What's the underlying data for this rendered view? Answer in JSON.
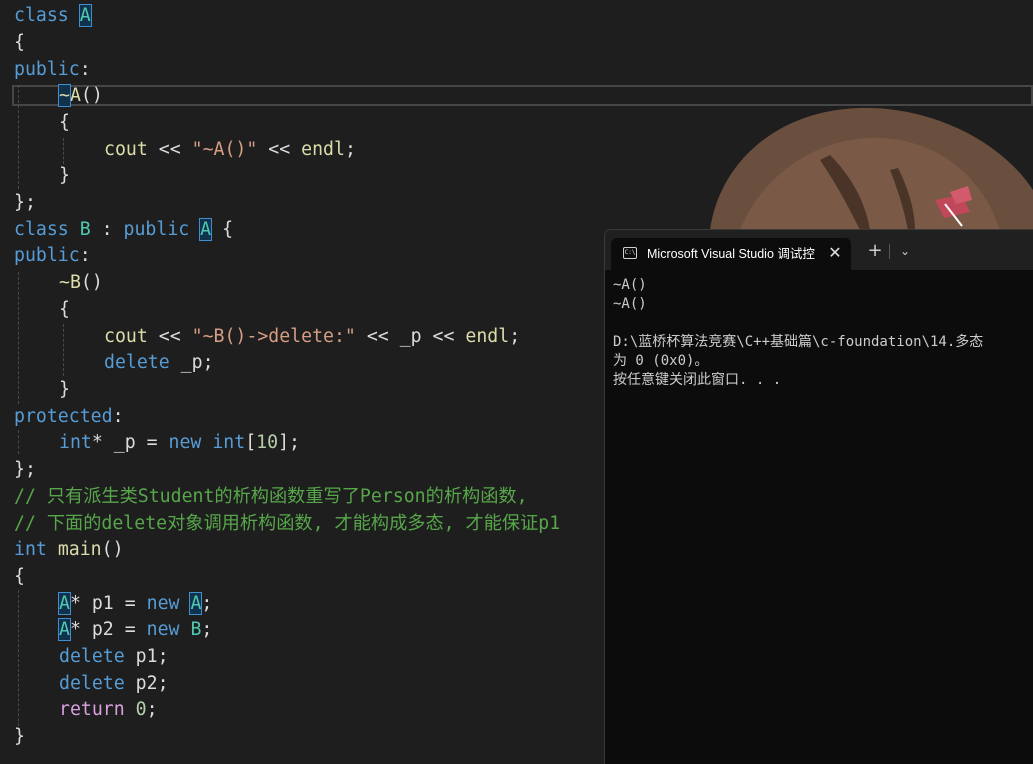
{
  "editor": {
    "lines": [
      [
        "class ",
        " ",
        "A",
        "\n{"
      ],
      [],
      [
        "public",
        ":"
      ],
      [
        "~",
        "A",
        "()"
      ],
      [
        "{"
      ],
      [
        "cout",
        " << ",
        "\"~A()\"",
        " << ",
        "endl",
        ";"
      ],
      [
        "}"
      ],
      [
        "};"
      ],
      [
        "class ",
        "B",
        " : ",
        "public ",
        "A",
        " {"
      ],
      [
        "public",
        ":"
      ],
      [
        "~B",
        "()"
      ],
      [
        "{"
      ],
      [
        "cout",
        " << ",
        "\"~B()->delete:\"",
        " << ",
        "_p",
        " << ",
        "endl",
        ";"
      ],
      [
        "delete ",
        "_p",
        ";"
      ],
      [
        "}"
      ],
      [
        "protected",
        ":"
      ],
      [
        "int",
        "* ",
        "_p",
        " = ",
        "new ",
        "int",
        "[",
        "10",
        "];"
      ],
      [
        "};"
      ],
      [
        "// 只有派生类Student的析构函数重写了Person的析构函数,"
      ],
      [
        "// 下面的delete对象调用析构函数, 才能构成多态, 才能保证p1"
      ],
      [
        "int ",
        "main",
        "()"
      ],
      [
        "{"
      ],
      [
        "A",
        "* ",
        "p1",
        " = ",
        "new ",
        "A",
        ";"
      ],
      [
        "A",
        "* ",
        "p2",
        " = ",
        "new ",
        "B",
        ";"
      ],
      [
        "delete ",
        "p1",
        ";"
      ],
      [
        "delete ",
        "p2",
        ";"
      ],
      [
        "return ",
        "0",
        ";"
      ],
      [
        "}"
      ]
    ]
  },
  "terminal": {
    "tab_icon": "C:\\",
    "tab_title": "Microsoft Visual Studio 调试控",
    "close_glyph": "✕",
    "new_tab_glyph": "+",
    "dropdown_glyph": "⌄",
    "output": [
      "~A()",
      "~A()",
      "",
      "D:\\蓝桥杯算法竞赛\\C++基础篇\\c-foundation\\14.多态",
      "为 0 (0x0)。",
      "按任意键关闭此窗口. . ."
    ]
  },
  "colors": {
    "editor_bg": "#1e1e1e",
    "keyword": "#569cd6",
    "control_keyword": "#d8a0df",
    "type": "#4ec9b0",
    "function": "#dcdcaa",
    "string": "#d69d85",
    "comment": "#57a64a",
    "number": "#b5cea8",
    "terminal_bg": "#0c0c0c"
  }
}
